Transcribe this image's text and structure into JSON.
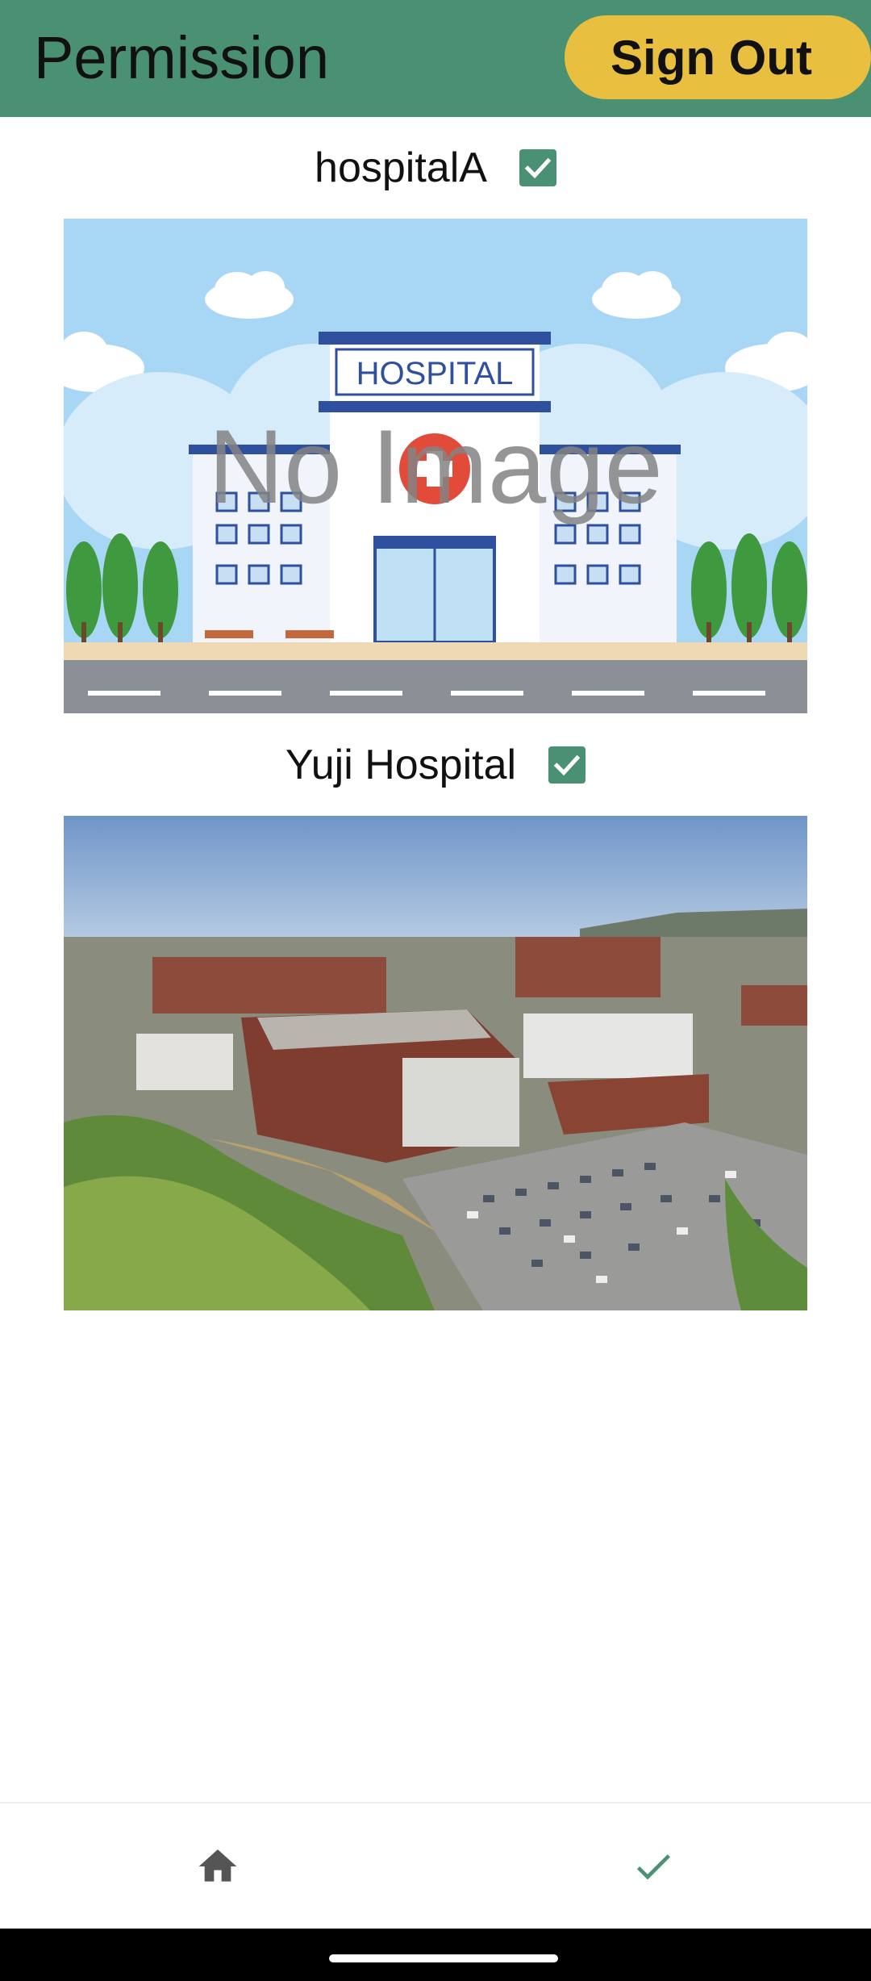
{
  "appbar": {
    "title": "Permission",
    "signout_label": "Sign Out"
  },
  "colors": {
    "appbar": "#4a9173",
    "signout": "#e9bf3f",
    "checkbox": "#4a9173",
    "nav_active": "#4a9173",
    "nav_inactive": "#555555"
  },
  "hospitals": [
    {
      "name": "hospitalA",
      "checked": true,
      "image_overlay": "No Image",
      "image_text": "HOSPITAL"
    },
    {
      "name": "Yuji Hospital",
      "checked": true
    }
  ],
  "bottom_nav": [
    {
      "icon": "home-icon",
      "active": false
    },
    {
      "icon": "check-icon",
      "active": true
    }
  ]
}
